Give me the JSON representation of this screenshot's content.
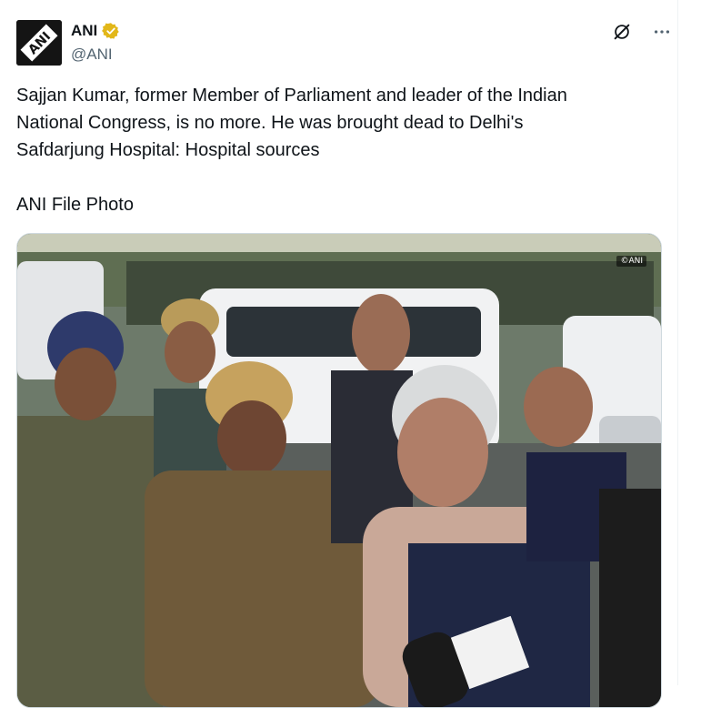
{
  "tweet": {
    "author": {
      "display_name": "ANI",
      "handle": "@ANI",
      "verified": true,
      "avatar_text": "ANI"
    },
    "text_lines": [
      "Sajjan Kumar, former Member of Parliament and leader of the Indian",
      "National Congress, is no more. He was brought dead to Delhi's",
      "Safdarjung Hospital: Hospital sources"
    ],
    "footer_line": "ANI File Photo",
    "media": {
      "watermark": "©ANI"
    }
  },
  "icons": {
    "grok": "grok-icon",
    "more": "more-icon",
    "verified": "verified-badge-icon"
  },
  "colors": {
    "verified_gold": "#e2b719",
    "handle_gray": "#536471",
    "text": "#0f1419"
  }
}
